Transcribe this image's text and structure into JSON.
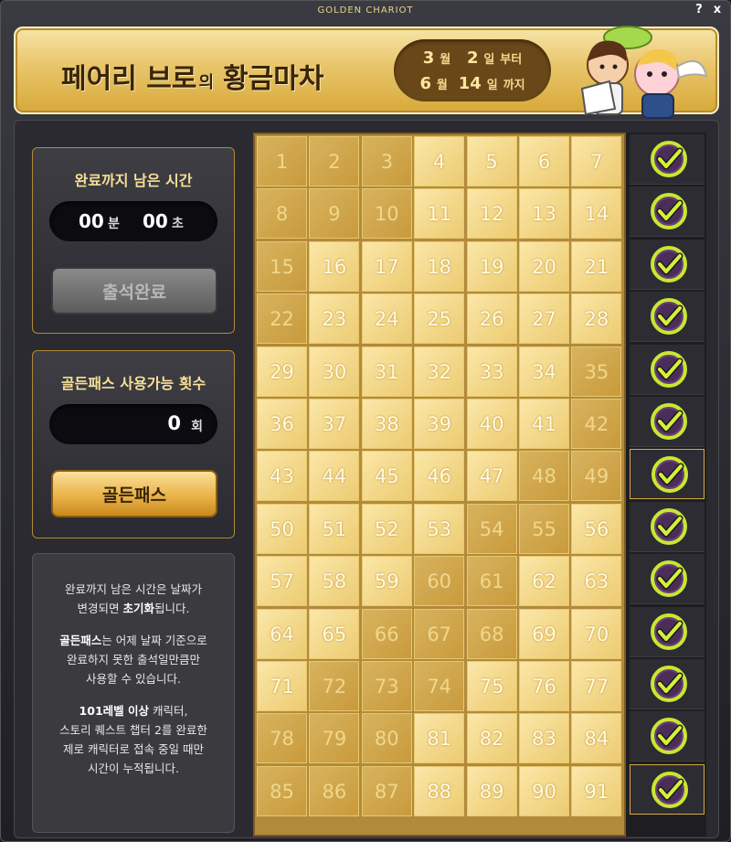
{
  "window": {
    "title": "GOLDEN CHARIOT",
    "help": "?",
    "close": "x"
  },
  "banner": {
    "title_main": "페어리 브로",
    "title_particle": "의",
    "title_end": "황금마차",
    "start": {
      "month": "3",
      "month_unit": "월",
      "day": "2",
      "day_unit": "일",
      "suffix": "부터"
    },
    "end": {
      "month": "6",
      "month_unit": "월",
      "day": "14",
      "day_unit": "일",
      "suffix": "까지"
    }
  },
  "timer": {
    "heading": "완료까지 남은 시간",
    "minutes": "00",
    "min_unit": "분",
    "seconds": "00",
    "sec_unit": "초",
    "button": "출석완료"
  },
  "pass": {
    "heading": "골든패스 사용가능 횟수",
    "count": "0",
    "unit": "회",
    "button": "골든패스"
  },
  "notes": {
    "p1_line1": "완료까지 남은 시간은 날짜가",
    "p1_line2_a": "변경되면 ",
    "p1_line2_b": "초기화",
    "p1_line2_c": "됩니다.",
    "p2_line1_a": "골든패스",
    "p2_line1_b": "는 어제 날짜 기준으로",
    "p2_line2": "완료하지 못한 출석일만큼만",
    "p2_line3": "사용할 수 있습니다.",
    "p3_line1_a": "101레벨 이상",
    "p3_line1_b": " 캐릭터,",
    "p3_line2": "스토리 퀘스트 챕터 2를 완료한",
    "p3_line3": "제로 캐릭터로 접속 중일 때만",
    "p3_line4": "시간이 누적됩니다."
  },
  "calendar": {
    "days": [
      "1",
      "2",
      "3",
      "4",
      "5",
      "6",
      "7",
      "8",
      "9",
      "10",
      "11",
      "12",
      "13",
      "14",
      "15",
      "16",
      "17",
      "18",
      "19",
      "20",
      "21",
      "22",
      "23",
      "24",
      "25",
      "26",
      "27",
      "28",
      "29",
      "30",
      "31",
      "32",
      "33",
      "34",
      "35",
      "36",
      "37",
      "38",
      "39",
      "40",
      "41",
      "42",
      "43",
      "44",
      "45",
      "46",
      "47",
      "48",
      "49",
      "50",
      "51",
      "52",
      "53",
      "54",
      "55",
      "56",
      "57",
      "58",
      "59",
      "60",
      "61",
      "62",
      "63",
      "64",
      "65",
      "66",
      "67",
      "68",
      "69",
      "70",
      "71",
      "72",
      "73",
      "74",
      "75",
      "76",
      "77",
      "78",
      "79",
      "80",
      "81",
      "82",
      "83",
      "84",
      "85",
      "86",
      "87",
      "88",
      "89",
      "90",
      "91"
    ]
  },
  "colors": {
    "gold": "#e9c56a",
    "check_green": "#c8e830"
  }
}
